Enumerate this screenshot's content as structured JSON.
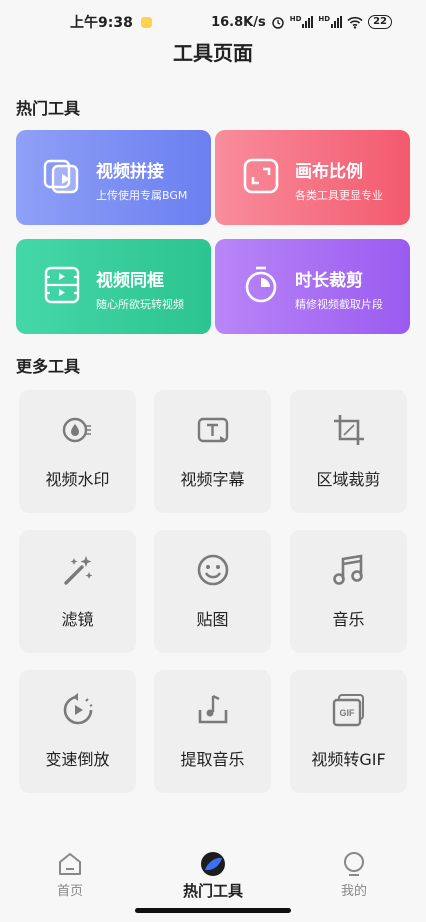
{
  "status_bar": {
    "time": "上午9:38",
    "net_speed": "16.8K/s",
    "sig1": "HD",
    "sig2": "HD",
    "battery": "22"
  },
  "page": {
    "title": "工具页面"
  },
  "hot_section": {
    "title": "热门工具",
    "cards": [
      {
        "name": "视频拼接",
        "desc": "上传使用专属BGM",
        "icon": "video-merge-icon",
        "gradient": [
          "#8d9cf6",
          "#6a7ff0"
        ]
      },
      {
        "name": "画布比例",
        "desc": "各类工具更显专业",
        "icon": "canvas-ratio-icon",
        "gradient": [
          "#f78a9a",
          "#f35d70"
        ]
      },
      {
        "name": "视频同框",
        "desc": "随心所欲玩转视频",
        "icon": "video-frame-icon",
        "gradient": [
          "#43d6a6",
          "#2cc592"
        ]
      },
      {
        "name": "时长裁剪",
        "desc": "精修视频截取片段",
        "icon": "timer-icon",
        "gradient": [
          "#b884f7",
          "#9a5cf0"
        ]
      }
    ]
  },
  "more_section": {
    "title": "更多工具",
    "tiles": [
      {
        "label": "视频水印",
        "icon": "watermark-icon"
      },
      {
        "label": "视频字幕",
        "icon": "subtitle-icon"
      },
      {
        "label": "区域裁剪",
        "icon": "crop-icon"
      },
      {
        "label": "滤镜",
        "icon": "filter-wand-icon"
      },
      {
        "label": "贴图",
        "icon": "sticker-smile-icon"
      },
      {
        "label": "音乐",
        "icon": "music-note-icon"
      },
      {
        "label": "变速倒放",
        "icon": "speed-reverse-icon"
      },
      {
        "label": "提取音乐",
        "icon": "extract-music-icon"
      },
      {
        "label": "视频转GIF",
        "icon": "gif-icon"
      }
    ]
  },
  "bottom_nav": {
    "items": [
      {
        "label": "首页",
        "icon": "home-icon"
      },
      {
        "label": "热门工具",
        "icon": "hot-tools-icon"
      },
      {
        "label": "我的",
        "icon": "profile-icon"
      }
    ]
  },
  "colors": {
    "icon_gray": "#7a7a7a",
    "accent_blue": "#3f6ff2"
  }
}
